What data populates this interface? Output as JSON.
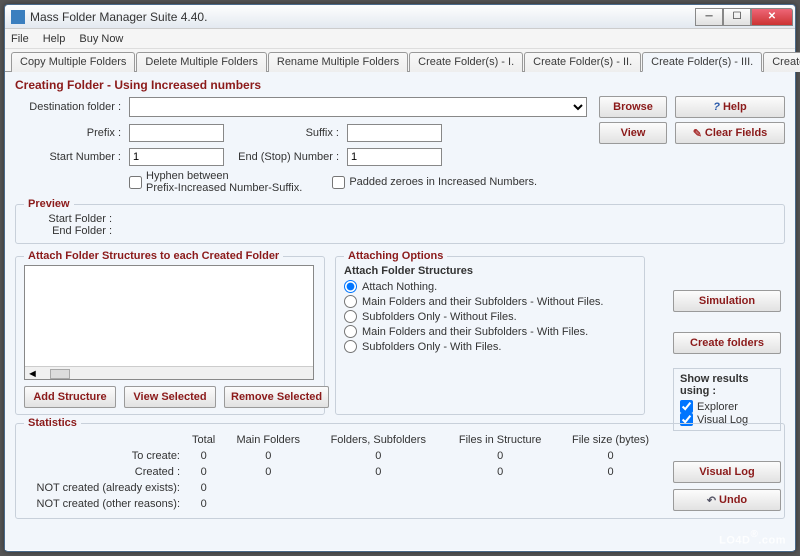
{
  "window": {
    "title": "Mass Folder Manager Suite 4.40."
  },
  "menu": {
    "file": "File",
    "help": "Help",
    "buy": "Buy Now"
  },
  "tabs": [
    "Copy Multiple Folders",
    "Delete Multiple Folders",
    "Rename Multiple Folders",
    "Create Folder(s)  - I.",
    "Create Folder(s)  - II.",
    "Create Folder(s)  - III.",
    "Create Folder -IV."
  ],
  "active_tab_index": 5,
  "section": {
    "title": "Creating Folder - Using Increased numbers",
    "dest_label": "Destination folder :",
    "dest_value": "",
    "prefix_label": "Prefix :",
    "prefix_value": "",
    "suffix_label": "Suffix :",
    "suffix_value": "",
    "start_label": "Start Number :",
    "start_value": "1",
    "end_label": "End (Stop) Number :",
    "end_value": "1",
    "hyphen_label": "Hyphen between\nPrefix-Increased Number-Suffix.",
    "padded_label": "Padded zeroes in Increased Numbers."
  },
  "buttons": {
    "browse": "Browse",
    "view": "View",
    "help": "Help",
    "clear": "Clear Fields",
    "simulation": "Simulation",
    "create": "Create folders",
    "visual_log": "Visual Log",
    "undo": "Undo",
    "add_struct": "Add Structure",
    "view_selected": "View Selected",
    "remove_selected": "Remove Selected"
  },
  "preview": {
    "legend": "Preview",
    "start_label": "Start Folder :",
    "start_value": "",
    "end_label": "End Folder :",
    "end_value": ""
  },
  "attach": {
    "legend": "Attach Folder Structures to each Created Folder",
    "options_legend": "Attaching Options",
    "options_sub": "Attach Folder Structures",
    "radios": [
      "Attach Nothing.",
      "Main Folders and their Subfolders - Without Files.",
      "Subfolders Only - Without Files.",
      "Main Folders and their Subfolders - With Files.",
      "Subfolders Only - With Files."
    ],
    "selected_radio": 0
  },
  "show_results": {
    "legend": "Show results using :",
    "explorer": "Explorer",
    "visual_log": "Visual Log"
  },
  "stats": {
    "legend": "Statistics",
    "headers": [
      "",
      "Total",
      "Main Folders",
      "Folders, Subfolders",
      "Files in Structure",
      "File size (bytes)"
    ],
    "rows": [
      {
        "label": "To create:",
        "vals": [
          "0",
          "0",
          "0",
          "0",
          "0"
        ]
      },
      {
        "label": "Created :",
        "vals": [
          "0",
          "0",
          "0",
          "0",
          "0"
        ]
      },
      {
        "label": "NOT created (already exists):",
        "vals": [
          "0",
          "",
          "",
          "",
          ""
        ]
      },
      {
        "label": "NOT created (other reasons):",
        "vals": [
          "0",
          "",
          "",
          "",
          ""
        ]
      }
    ]
  },
  "watermark": "LO4D"
}
